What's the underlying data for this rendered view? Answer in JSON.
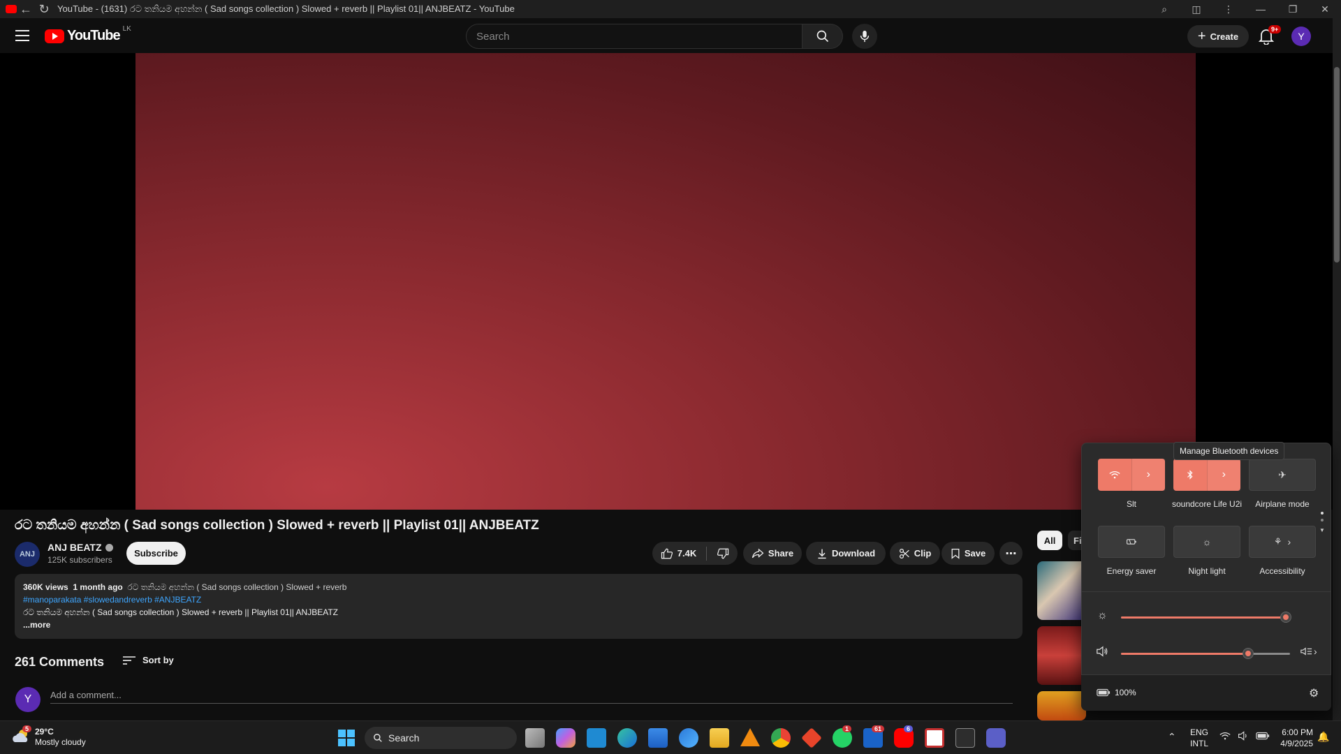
{
  "browser": {
    "title": "YouTube - (1631) රට තනියම අහන්න ( Sad songs collection ) Slowed + reverb || Playlist 01|| ANJBEATZ - YouTube"
  },
  "header": {
    "logo_text": "YouTube",
    "country_code": "LK",
    "search_placeholder": "Search",
    "create_label": "Create",
    "notifications_badge": "9+",
    "avatar_letter": "Y"
  },
  "video": {
    "title": "රට තනියම අහන්න ( Sad songs collection ) Slowed + reverb || Playlist 01|| ANJBEATZ",
    "channel_name": "ANJ BEATZ",
    "channel_logo_text": "ANJ",
    "subscribers": "125K subscribers",
    "subscribe_label": "Subscribe",
    "likes": "7.4K",
    "share_label": "Share",
    "download_label": "Download",
    "clip_label": "Clip",
    "save_label": "Save"
  },
  "description": {
    "views": "360K views",
    "age": "1 month ago",
    "inline_title": "රට තනියම අහන්න ( Sad songs collection ) Slowed + reverb",
    "hashtags": "#manoparakata #slowedandreverb #ANJBEATZ",
    "line2": "රට තනියම අහන්න ( Sad songs collection ) Slowed + reverb || Playlist 01|| ANJBEATZ",
    "more_label": "...more"
  },
  "comments": {
    "count_label": "261 Comments",
    "sort_label": "Sort by",
    "avatar_letter": "Y",
    "placeholder": "Add a comment..."
  },
  "related": {
    "chip_all": "All",
    "chip_next": "Fi"
  },
  "quick_settings": {
    "tooltip": "Manage Bluetooth devices",
    "tiles": [
      {
        "label": "Slt",
        "state": "on",
        "icon": "wifi-icon"
      },
      {
        "label": "soundcore Life U2i",
        "state": "on",
        "icon": "bluetooth-icon"
      },
      {
        "label": "Airplane mode",
        "state": "off",
        "icon": "airplane-icon"
      },
      {
        "label": "Energy saver",
        "state": "off",
        "icon": "energy-saver-icon"
      },
      {
        "label": "Night light",
        "state": "off",
        "icon": "night-light-icon"
      },
      {
        "label": "Accessibility",
        "state": "off",
        "icon": "accessibility-icon"
      }
    ],
    "brightness_level": 1.0,
    "volume_level": 0.75,
    "battery_label": "100%"
  },
  "taskbar": {
    "weather_temp": "29°C",
    "weather_desc": "Mostly cloudy",
    "weather_badge": "5",
    "search_label": "Search",
    "whatsapp_badge": "1",
    "mail_badge": "61",
    "youtube_badge": "6",
    "lang_top": "ENG",
    "lang_bottom": "INTL",
    "time": "6:00 PM",
    "date": "4/9/2025"
  },
  "colors": {
    "youtube_red": "#ff0000",
    "accent_windows": "#ee7a68",
    "link_blue": "#3ea6ff"
  }
}
